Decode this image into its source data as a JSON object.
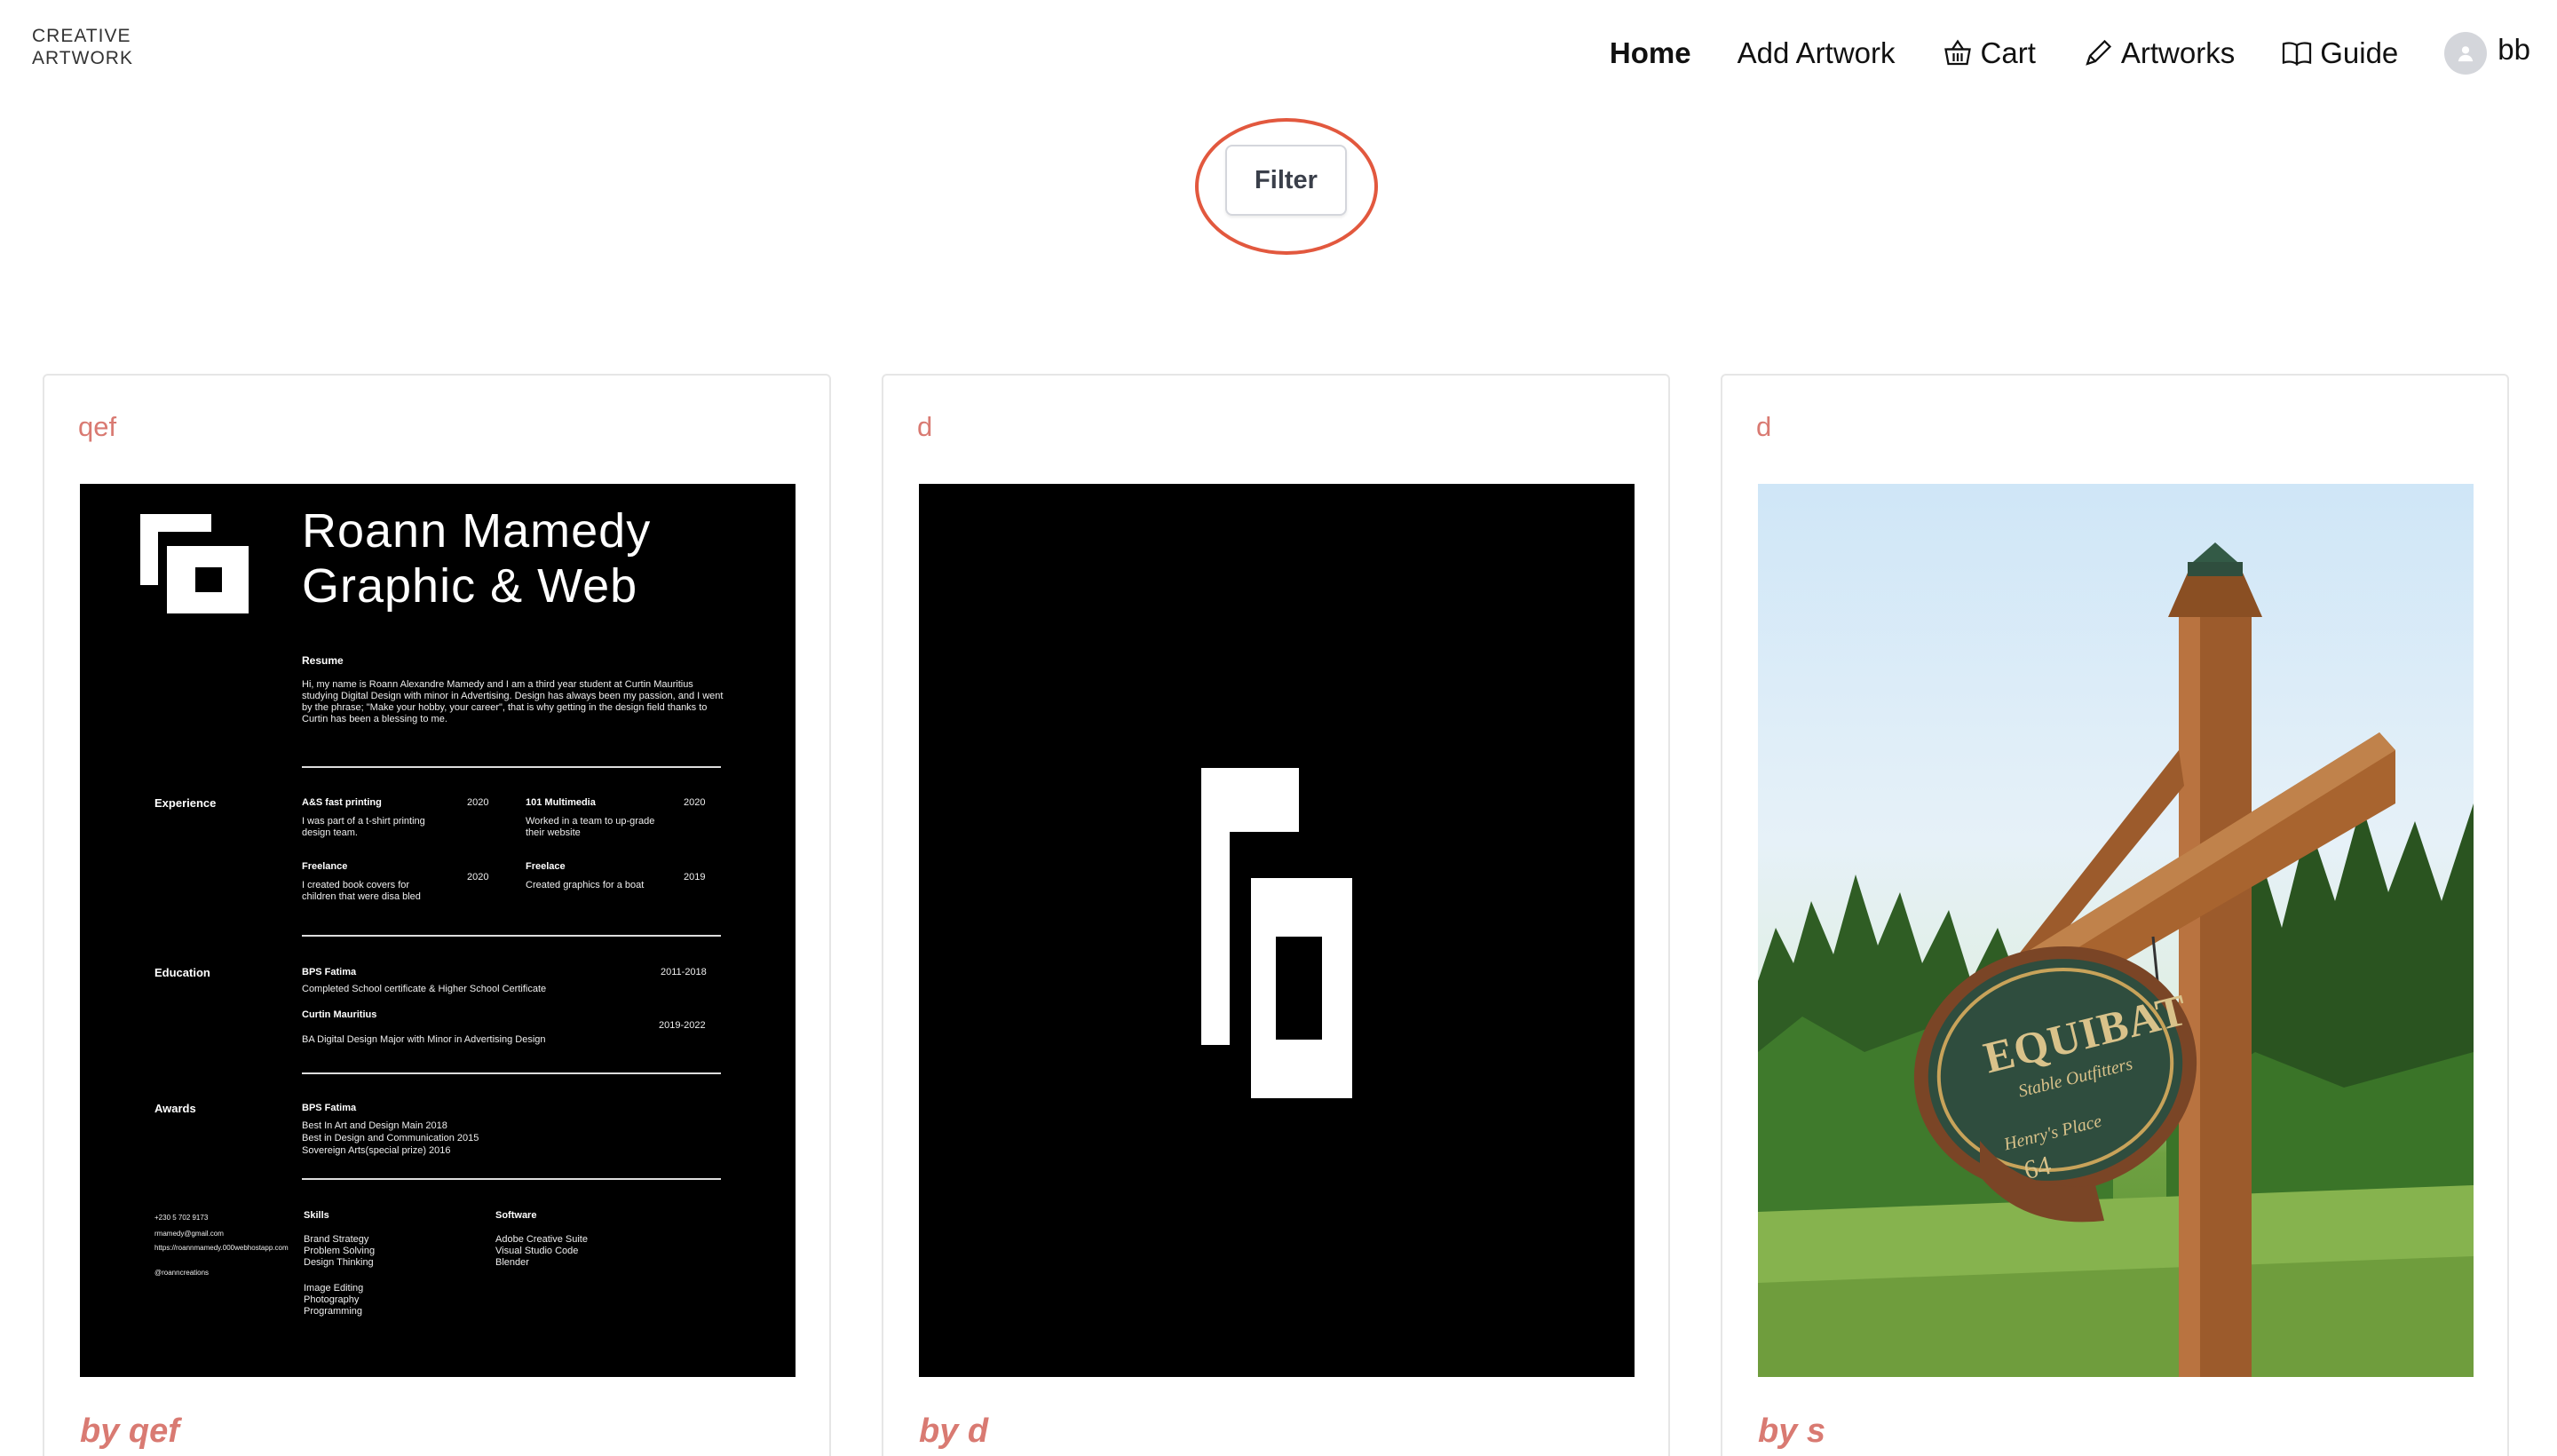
{
  "brand": {
    "line1": "CREATIVE",
    "line2": "ARTWORK"
  },
  "nav": {
    "home": "Home",
    "add_artwork": "Add Artwork",
    "cart": "Cart",
    "artworks": "Artworks",
    "guide": "Guide",
    "user": "bb"
  },
  "filter": {
    "label": "Filter",
    "highlight_color": "#e2583e"
  },
  "cards": [
    {
      "title": "qef",
      "author": "by qef",
      "art": {
        "name_line1": "Roann Mamedy",
        "name_line2": "Graphic & Web",
        "resume_label": "Resume",
        "resume_text": "Hi, my name is Roann Alexandre Mamedy and I am a third year student at Curtin Mauritius studying Digital Design with minor in Advertising. Design has always been my passion, and I went by the phrase; \"Make your hobby, your career\", that is why getting in the design field thanks to Curtin has been a blessing to me.",
        "experience_label": "Experience",
        "exp1_title": "A&S fast printing",
        "exp1_year": "2020",
        "exp1_text": "I was part of a t-shirt printing design team.",
        "exp2_title": "101 Multimedia",
        "exp2_year": "2020",
        "exp2_text": "Worked in a team to up-grade their website",
        "exp3_title": "Freelance",
        "exp3_year": "2020",
        "exp3_text": "I created book covers for children that were disa bled",
        "exp4_title": "Freelace",
        "exp4_year": "2019",
        "exp4_text": "Created graphics for a boat",
        "education_label": "Education",
        "edu1_title": "BPS Fatima",
        "edu1_year": "2011-2018",
        "edu1_text": "Completed School certificate & Higher School Certificate",
        "edu2_title": "Curtin Mauritius",
        "edu2_year": "2019-2022",
        "edu2_text": "BA Digital Design Major with Minor in Advertising Design",
        "awards_label": "Awards",
        "award_title": "BPS Fatima",
        "award1": "Best In Art and Design Main 2018",
        "award2": "Best in Design and Communication 2015",
        "award3": "Sovereign Arts(special prize) 2016",
        "contact1": "+230 5 702 9173",
        "contact2": "rmamedy@gmail.com",
        "contact3": "https://roannmamedy.000webhostapp.com",
        "contact4": "@roanncreations",
        "skills_label": "Skills",
        "skill1": "Brand Strategy",
        "skill2": "Problem Solving",
        "skill3": "Design Thinking",
        "skill4": "Image Editing",
        "skill5": "Photography",
        "skill6": "Programming",
        "software_label": "Software",
        "soft1": "Adobe Creative Suite",
        "soft2": "Visual Studio Code",
        "soft3": "Blender"
      }
    },
    {
      "title": "d",
      "author": "by d"
    },
    {
      "title": "d",
      "author": "by s",
      "sign": {
        "line1": "EQUIBAT",
        "line2": "Stable Outfitters",
        "line3": "Henry's Place",
        "line4": "64"
      }
    }
  ],
  "colors": {
    "accent": "#d97a72",
    "text": "#111111"
  }
}
